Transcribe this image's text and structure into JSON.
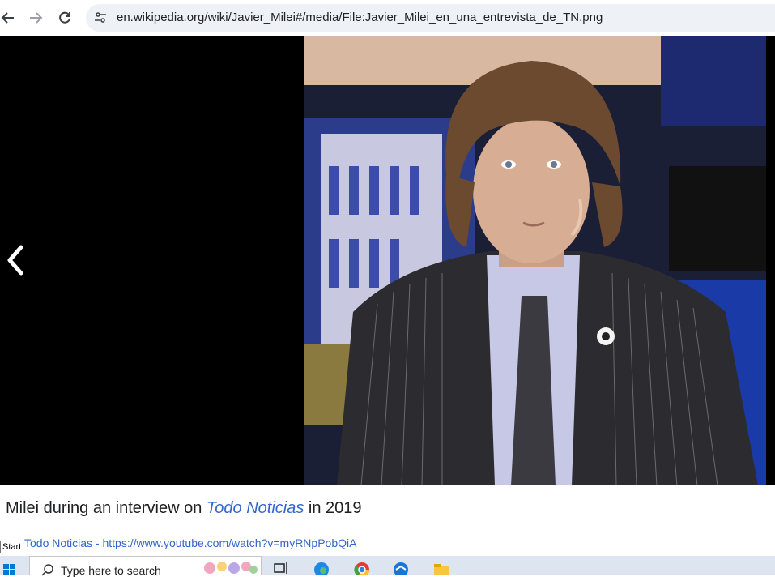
{
  "browser": {
    "url": "en.wikipedia.org/wiki/Javier_Milei#/media/File:Javier_Milei_en_una_entrevista_de_TN.png"
  },
  "viewer": {
    "caption_before": "Milei during an interview on ",
    "caption_italic": "Todo Noticias",
    "caption_after": " in 2019",
    "source_text": "Todo Noticias - https://www.youtube.com/watch?v=myRNpPobQiA",
    "tooltip": "Start"
  },
  "taskbar": {
    "search_placeholder": "Type here to search",
    "icons": [
      "windows-icon",
      "search-icon",
      "task-view-icon",
      "edge-icon",
      "chrome-icon",
      "mail-icon",
      "file-explorer-icon"
    ]
  },
  "colors": {
    "link": "#3366cc",
    "viewer_bg": "#000000",
    "address_bg": "#eef1f6"
  }
}
